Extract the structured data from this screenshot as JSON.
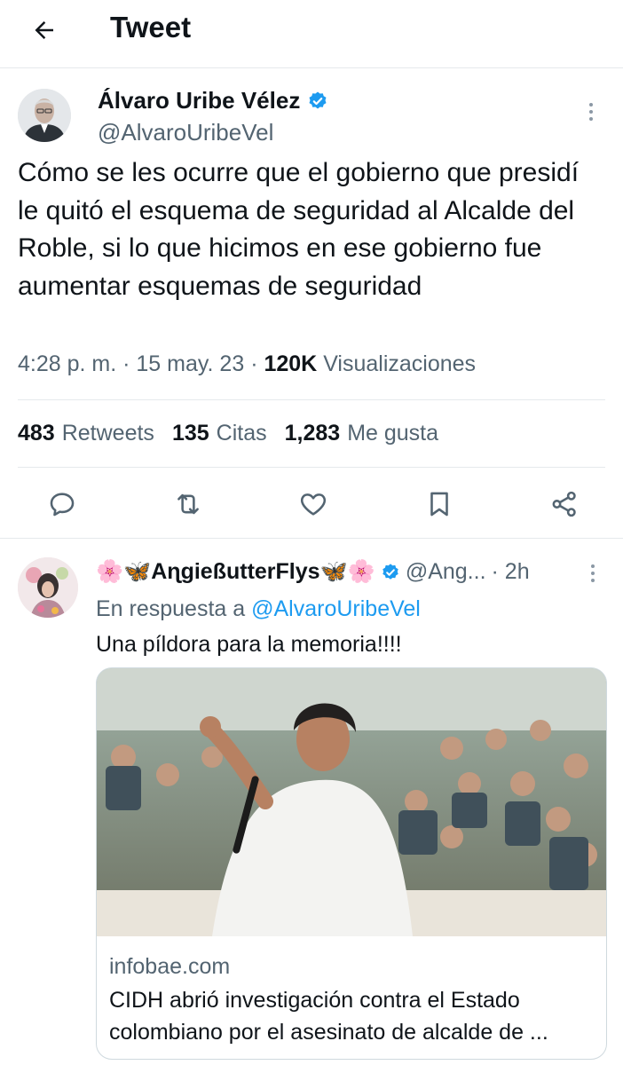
{
  "header": {
    "title": "Tweet"
  },
  "tweet": {
    "author_name": "Álvaro Uribe Vélez",
    "author_handle": "@AlvaroUribeVel",
    "text": "Cómo se les ocurre que el gobierno que presidí le quitó el esquema de seguridad al Alcalde del Roble, si lo que hicimos en ese gobierno fue aumentar esquemas de seguridad",
    "time": "4:28 p. m.",
    "date": "15 may. 23",
    "views": "120K",
    "views_label": "Visualizaciones",
    "sep": "·",
    "stats": {
      "retweets": "483",
      "retweets_label": "Retweets",
      "quotes": "135",
      "quotes_label": "Citas",
      "likes": "1,283",
      "likes_label": "Me gusta"
    }
  },
  "reply": {
    "author_name": "🌸🦋AɳgießutterFlys🦋🌸",
    "author_handle": "@Ang...",
    "time": "· 2h",
    "replying_prefix": "En respuesta a",
    "replying_to": "@AlvaroUribeVel",
    "text": "Una píldora para la memoria!!!!",
    "card": {
      "domain": "infobae.com",
      "title": "CIDH abrió investigación contra el Estado colombiano por el asesinato de alcalde de ..."
    }
  },
  "colors": {
    "accent": "#1d9bf0",
    "text": "#0f1419",
    "secondary": "#536471",
    "border": "#e6e9ec"
  }
}
